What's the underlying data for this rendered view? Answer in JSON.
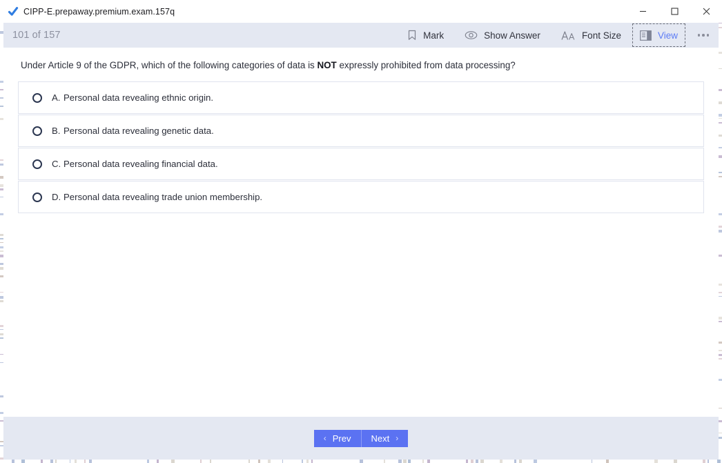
{
  "window": {
    "title": "CIPP-E.prepaway.premium.exam.157q",
    "app_icon": "checkmark-icon",
    "controls": {
      "minimize": "–",
      "maximize": "☐",
      "close": "✕"
    }
  },
  "toolbar": {
    "counter": "101 of 157",
    "mark_label": "Mark",
    "show_answer_label": "Show Answer",
    "font_size_label": "Font Size",
    "view_label": "View",
    "more_label": "…",
    "accent_color": "#5d7cf5",
    "background_color": "#e4e8f2"
  },
  "question": {
    "text_before": "Under Article 9 of the GDPR, which of the following categories of data is ",
    "emphasis": "NOT",
    "text_after": " expressly prohibited from data processing?"
  },
  "options": [
    {
      "letter": "A.",
      "text": "Personal data revealing ethnic origin.",
      "selected": false
    },
    {
      "letter": "B.",
      "text": "Personal data revealing genetic data.",
      "selected": false
    },
    {
      "letter": "C.",
      "text": "Personal data revealing financial data.",
      "selected": false
    },
    {
      "letter": "D.",
      "text": "Personal data revealing trade union membership.",
      "selected": false
    }
  ],
  "footer": {
    "prev_label": "Prev",
    "next_label": "Next",
    "prev_chevron": "‹",
    "next_chevron": "›",
    "button_color": "#5b72f2"
  }
}
